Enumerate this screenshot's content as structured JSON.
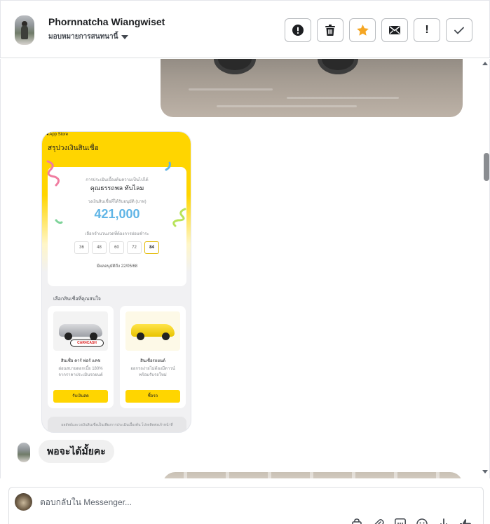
{
  "header": {
    "contact_name": "Phornnatcha Wiangwiset",
    "assign_label": "มอบหมายการสนทนานี้",
    "actions": [
      {
        "name": "report-spam",
        "icon": "alert-circle-icon"
      },
      {
        "name": "delete",
        "icon": "trash-icon"
      },
      {
        "name": "star",
        "icon": "star-icon",
        "color": "#f5a623"
      },
      {
        "name": "mark-unread",
        "icon": "envelope-icon"
      },
      {
        "name": "follow-up",
        "icon": "exclamation-icon",
        "label": "!"
      },
      {
        "name": "done",
        "icon": "check-icon"
      }
    ]
  },
  "conversation": {
    "shared_screenshot": {
      "app_store": "◂ App Store",
      "title": "สรุปวงเงินสินเชื่อ",
      "eligibility_line": "การประเมินเบื้องต้นความเป็นไปได้",
      "customer_name": "คุณธรรถพล ทับไลม",
      "amount_caption": "วงเงินสินเชื่อที่ได้รับอนุมัติ (บาท)",
      "amount": "421,000",
      "term_caption": "เลือกจำนวนงวดที่ต้องการผ่อนชำระ",
      "terms": [
        "36",
        "48",
        "60",
        "72",
        "84"
      ],
      "selected_term": "84",
      "valid_until": "มีผลอนุมัติถึง 22/05/68",
      "products_caption": "เลือกสินเชื่อที่คุณสนใจ",
      "products": [
        {
          "title": "สินเชื่อ คาร์ ฟอร์ แคช",
          "desc": "ผ่อนสบายดอกเบี้ย 180%\nจากราคาประเมินรถยนต์",
          "button": "รับเงินสด",
          "logo": "CAR4CASH"
        },
        {
          "title": "สินเชื่อรถยนต์",
          "desc": "ออกรถง่ายไม่ต้องมีดาวน์\nพร้อมรับรถใหม่",
          "button": "ซื้อรถ"
        }
      ],
      "disclaimer": "ผลลัพธ์และวงเงินสินเชื่อเป็นเพียงการประเมินเบื้องต้น โปรดติดต่อเจ้าหน้าที่"
    },
    "incoming_text": "พอจะได้มั้ยคะ"
  },
  "composer": {
    "placeholder": "ตอบกลับใน Messenger...",
    "tools": [
      "bag-icon",
      "paperclip-icon",
      "gif-icon",
      "emoji-icon",
      "thumb-icon",
      "like-icon"
    ]
  }
}
